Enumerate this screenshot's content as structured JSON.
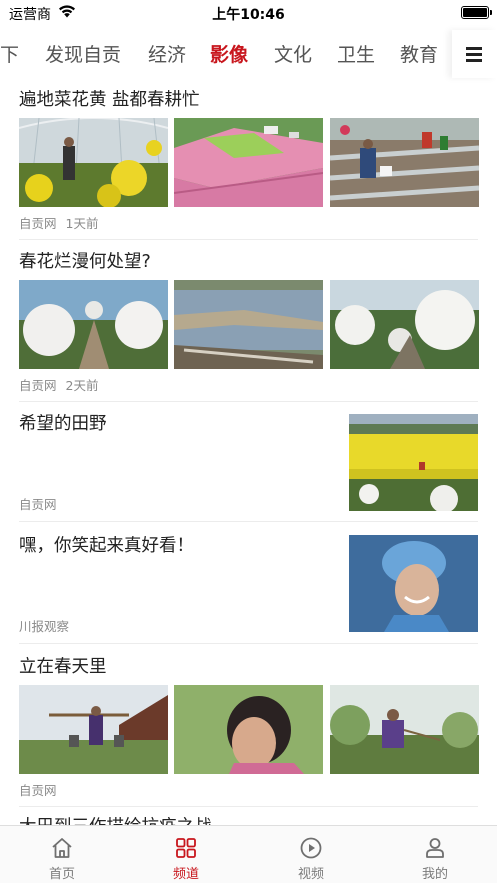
{
  "status_bar": {
    "carrier": "运营商",
    "time": "上午10:46",
    "battery_level": 1.0
  },
  "channels": {
    "tabs": [
      "下",
      "发现自贡",
      "经济",
      "影像",
      "文化",
      "卫生",
      "教育"
    ],
    "active": "影像",
    "menu_icon": "menu-icon"
  },
  "feed": [
    {
      "title": "遍地菜花黄 盐都春耕忙",
      "source": "自贡网",
      "time": "1天前",
      "layout": "three-images"
    },
    {
      "title": "春花烂漫何处望?",
      "source": "自贡网",
      "time": "2天前",
      "layout": "three-images"
    },
    {
      "title": "希望的田野",
      "source": "自贡网",
      "layout": "side-image"
    },
    {
      "title": "嘿，你笑起来真好看！",
      "source": "川报观察",
      "layout": "side-image"
    },
    {
      "title": "立在春天里",
      "source": "自贡网",
      "layout": "three-images"
    },
    {
      "title": "大巴到三作描绘抗疫之战",
      "layout": "partial"
    }
  ],
  "bottom_tabs": [
    {
      "label": "首页",
      "icon": "home-icon"
    },
    {
      "label": "频道",
      "icon": "channels-grid-icon"
    },
    {
      "label": "视频",
      "icon": "play-circle-icon"
    },
    {
      "label": "我的",
      "icon": "user-icon"
    }
  ],
  "active_bottom_tab": "频道",
  "colors": {
    "accent": "#c8161d",
    "meta_text": "#8a8a8a",
    "tab_inactive": "#555555"
  }
}
